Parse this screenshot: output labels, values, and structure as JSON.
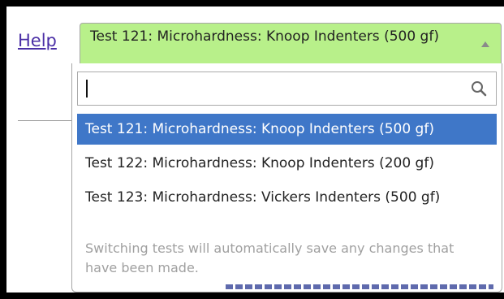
{
  "help_link": "Help",
  "select": {
    "selected_value": "Test 121: Microhardness: Knoop Indenters (500 gf)"
  },
  "dropdown": {
    "search": {
      "value": "",
      "placeholder": ""
    },
    "options": [
      {
        "label": "Test 121: Microhardness: Knoop Indenters (500 gf)",
        "selected": true
      },
      {
        "label": "Test 122: Microhardness: Knoop Indenters (200 gf)",
        "selected": false
      },
      {
        "label": "Test 123: Microhardness: Vickers Indenters (500 gf)",
        "selected": false
      }
    ],
    "note": "Switching tests will automatically save any changes that have been made."
  },
  "colors": {
    "select_background": "#b8f08a",
    "selected_option": "#3f77c8",
    "link": "#4b2fa6",
    "note_text": "#a0a0a0"
  },
  "icons": {
    "search": "search-icon",
    "caret": "caret-up-icon"
  }
}
